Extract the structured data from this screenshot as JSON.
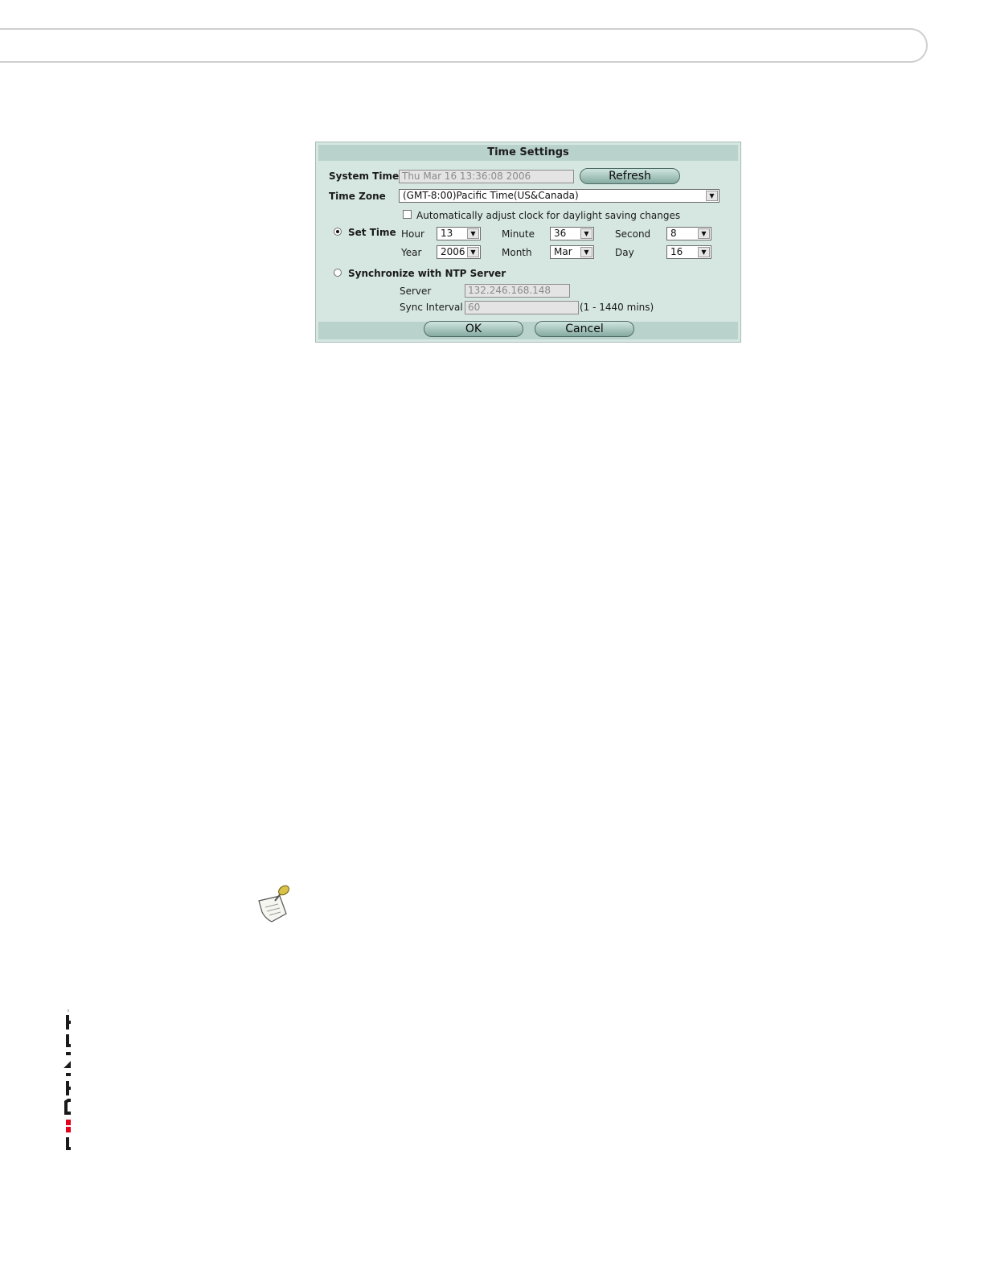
{
  "dialog": {
    "title": "Time Settings",
    "system_time_label": "System Time",
    "system_time_value": "Thu Mar 16 13:36:08 2006",
    "refresh_label": "Refresh",
    "time_zone_label": "Time Zone",
    "time_zone_value": "(GMT-8:00)Pacific Time(US&Canada)",
    "dst_label": "Automatically adjust clock for daylight saving changes",
    "dst_checked": false,
    "set_time_label": "Set Time",
    "set_time_selected": true,
    "hour_label": "Hour",
    "hour_value": "13",
    "minute_label": "Minute",
    "minute_value": "36",
    "second_label": "Second",
    "second_value": "8",
    "year_label": "Year",
    "year_value": "2006",
    "month_label": "Month",
    "month_value": "Mar",
    "day_label": "Day",
    "day_value": "16",
    "ntp_label": "Synchronize with NTP Server",
    "ntp_selected": false,
    "server_label": "Server",
    "server_value": "132.246.168.148",
    "sync_interval_label": "Sync Interval",
    "sync_interval_value": "60",
    "sync_interval_hint": "(1 - 1440 mins)",
    "ok_label": "OK",
    "cancel_label": "Cancel"
  },
  "colors": {
    "dialog_bg": "#d6e7e2",
    "title_bar": "#b9d3cc",
    "logo_red": "#e3001b"
  },
  "icons": [
    "note-pin-icon",
    "fortinet-logo"
  ],
  "logo_text": "FORTINET"
}
